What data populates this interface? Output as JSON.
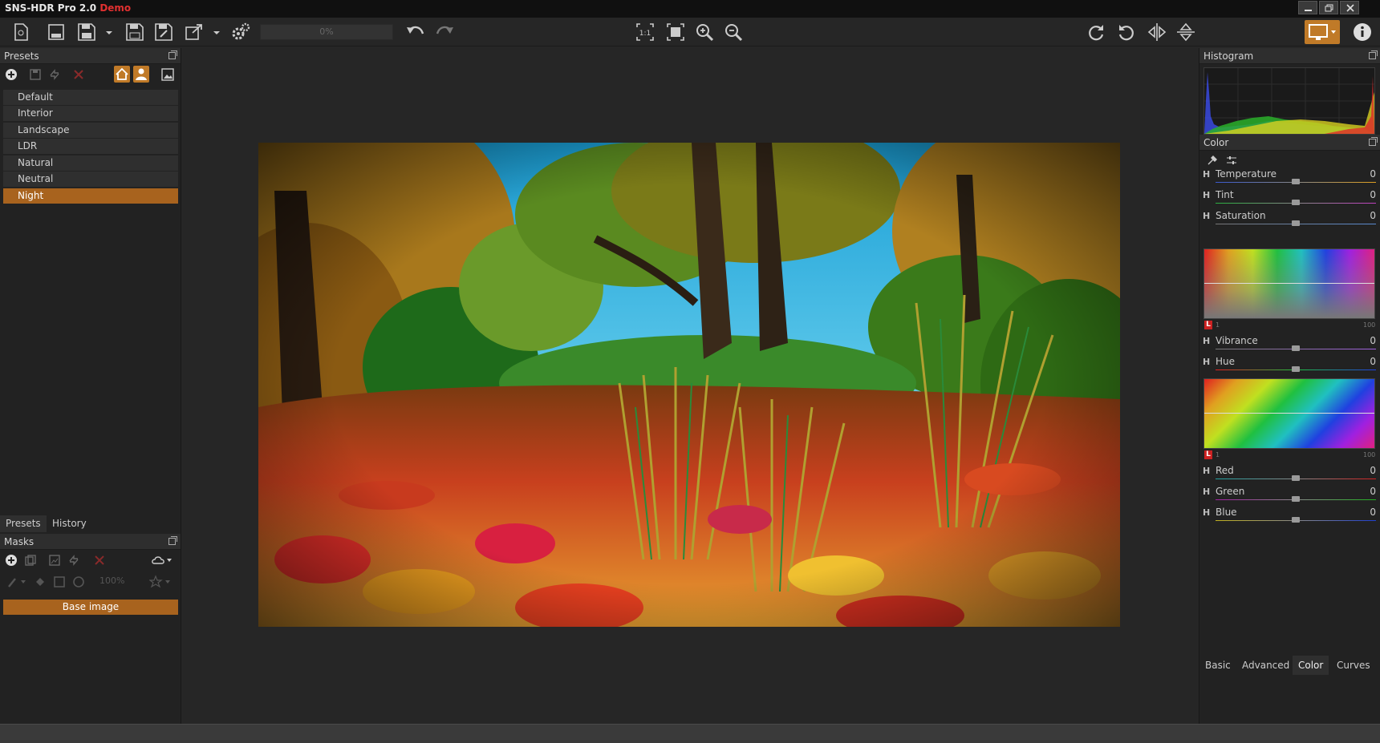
{
  "window": {
    "title": "SNS-HDR Pro 2.0",
    "edition": "Demo"
  },
  "toolbar": {
    "progress": "0%",
    "icons": [
      "new-file-icon",
      "sns-open-icon",
      "save-sns-icon",
      "save-icon",
      "save-as-icon",
      "export-icon",
      "settings-gears-icon",
      "undo-icon",
      "redo-icon",
      "actual-size-icon",
      "fit-icon",
      "zoom-in-icon",
      "zoom-out-icon",
      "rotate-cw-icon",
      "rotate-ccw-icon",
      "flip-horizontal-icon",
      "flip-vertical-icon",
      "monitor-icon",
      "info-icon"
    ]
  },
  "presets_panel": {
    "title": "Presets",
    "items": [
      {
        "label": "Default",
        "selected": false
      },
      {
        "label": "Interior",
        "selected": false
      },
      {
        "label": "Landscape",
        "selected": false
      },
      {
        "label": "LDR",
        "selected": false
      },
      {
        "label": "Natural",
        "selected": false
      },
      {
        "label": "Neutral",
        "selected": false
      },
      {
        "label": "Night",
        "selected": true
      }
    ],
    "tabs": [
      "Presets",
      "History"
    ]
  },
  "masks_panel": {
    "title": "Masks",
    "opacity": "100%",
    "layers": [
      "Base image"
    ]
  },
  "histogram_panel": {
    "title": "Histogram"
  },
  "color_panel": {
    "title": "Color",
    "flag": "H",
    "badge": "L",
    "scale_min": "1",
    "scale_max": "100",
    "sliders_top": [
      {
        "label": "Temperature",
        "value": "0",
        "level": 0.5
      },
      {
        "label": "Tint",
        "value": "0",
        "level": 0.5
      },
      {
        "label": "Saturation",
        "value": "0",
        "level": 0.5
      }
    ],
    "sliders_mid": [
      {
        "label": "Vibrance",
        "value": "0",
        "level": 0.5
      },
      {
        "label": "Hue",
        "value": "0",
        "level": 0.5
      }
    ],
    "sliders_rgb": [
      {
        "label": "Red",
        "value": "0",
        "level": 0.5
      },
      {
        "label": "Green",
        "value": "0",
        "level": 0.5
      },
      {
        "label": "Blue",
        "value": "0",
        "level": 0.5
      }
    ]
  },
  "bottom_tabs": [
    {
      "label": "Basic",
      "active": false
    },
    {
      "label": "Advanced",
      "active": false
    },
    {
      "label": "Color",
      "active": true
    },
    {
      "label": "Curves",
      "active": false
    }
  ],
  "colors": {
    "accent": "#a8631e",
    "panel": "#222222",
    "toolbar": "#262626",
    "demo_red": "#e03030"
  }
}
